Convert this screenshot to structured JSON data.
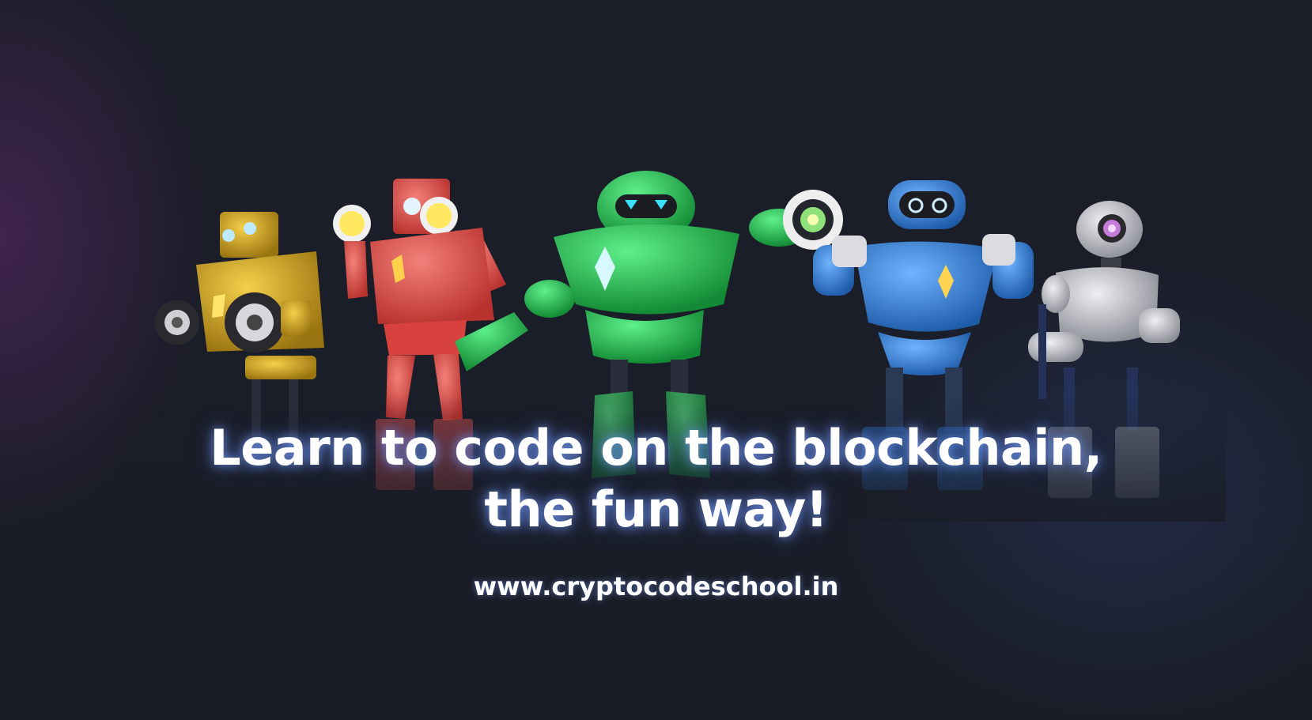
{
  "headline": {
    "line1": "Learn to code on the blockchain,",
    "line2": "the fun way!"
  },
  "website": "www.cryptocodeschool.in",
  "robots": [
    {
      "name": "yellow-robot",
      "color": "#d6a51c"
    },
    {
      "name": "red-robot",
      "color": "#e0504c"
    },
    {
      "name": "green-robot",
      "color": "#22b54a"
    },
    {
      "name": "blue-robot",
      "color": "#2f7fd6"
    },
    {
      "name": "silver-robot",
      "color": "#b9bcc4"
    }
  ],
  "colors": {
    "background": "#1a1d27",
    "text": "#ffffff",
    "glow": "#7aa0ff"
  }
}
